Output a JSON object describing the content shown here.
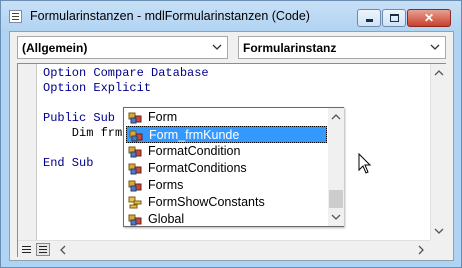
{
  "window": {
    "title": "Formularinstanzen - mdlFormularinstanzen (Code)",
    "controls": {
      "minimize": "min",
      "maximize": "max",
      "close": "✕"
    }
  },
  "toolbar": {
    "object_combo": "(Allgemein)",
    "procedure_combo": "Formularinstanz"
  },
  "code": {
    "lines": [
      "Option Compare Database",
      "Option Explicit",
      "",
      "Public Sub Formularinstanz()",
      "    Dim frm As Form",
      "",
      "End Sub"
    ]
  },
  "intellisense": {
    "selected_index": 1,
    "items": [
      {
        "label": "Form",
        "icon": "class-icon"
      },
      {
        "label": "Form_frmKunde",
        "icon": "class-icon"
      },
      {
        "label": "FormatCondition",
        "icon": "class-icon"
      },
      {
        "label": "FormatConditions",
        "icon": "class-icon"
      },
      {
        "label": "Forms",
        "icon": "class-icon"
      },
      {
        "label": "FormShowConstants",
        "icon": "enum-icon"
      },
      {
        "label": "Global",
        "icon": "class-icon"
      }
    ]
  },
  "colors": {
    "keyword": "#00008b",
    "selection": "#3399ff",
    "titlebar": "#b9d7f4"
  }
}
